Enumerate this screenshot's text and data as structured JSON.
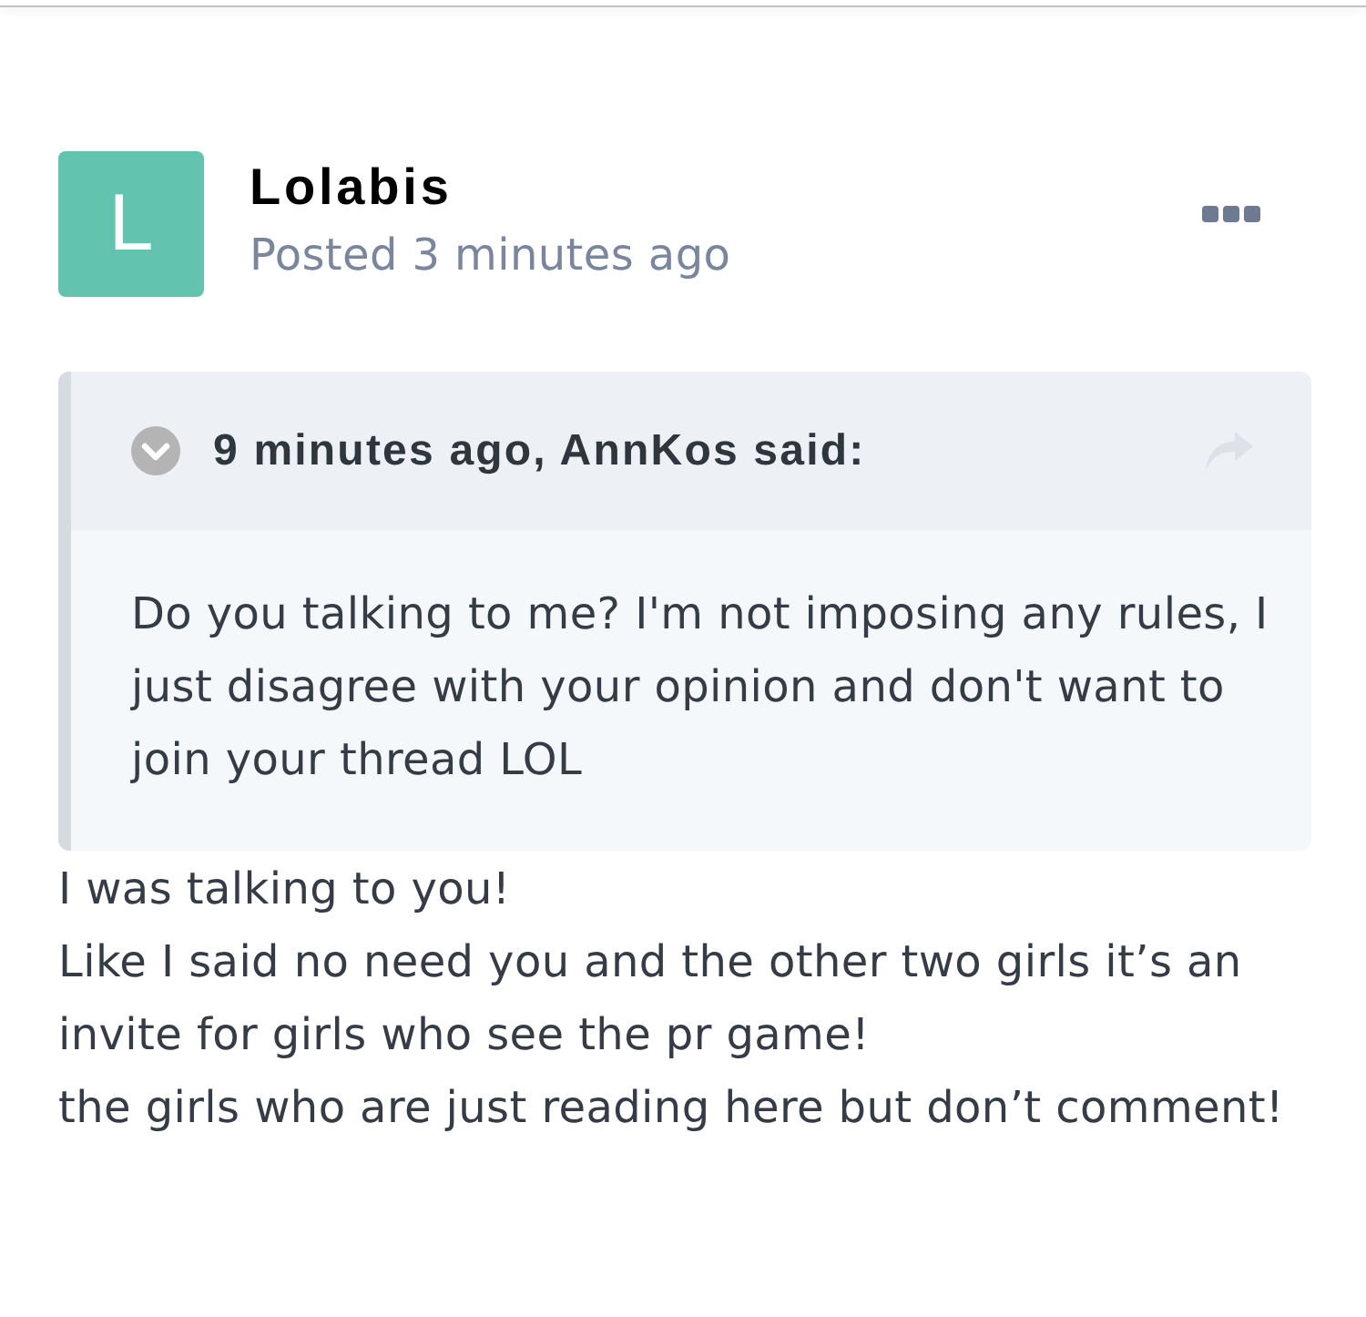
{
  "post": {
    "author": {
      "name": "Lolabis",
      "avatar_letter": "L"
    },
    "posted": "Posted 3 minutes ago",
    "quote": {
      "citation": "9 minutes ago, AnnKos said:",
      "text": "Do you talking to me? I'm not imposing any rules, I just disagree with your opinion and don't want to join your thread LOL"
    },
    "paragraphs": [
      "I was talking to you!",
      "Like I said no need you and the other two girls it’s an invite for girls who see the pr game!",
      "the girls who are just reading here but don’t comment!"
    ]
  }
}
